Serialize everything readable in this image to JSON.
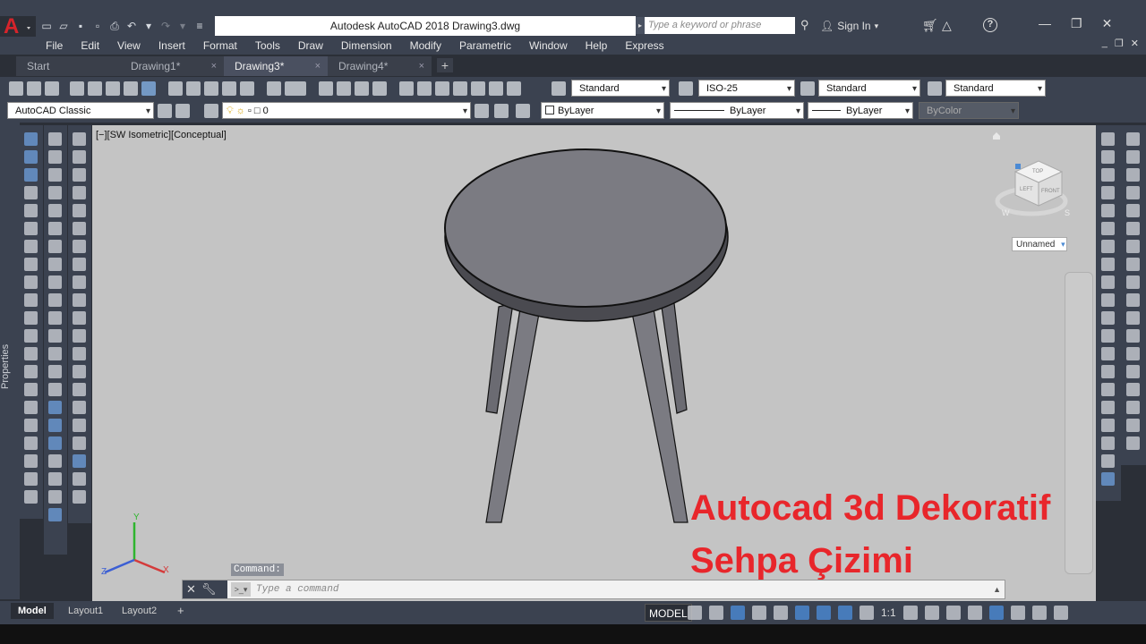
{
  "app": {
    "title": "Autodesk AutoCAD 2018    Drawing3.dwg",
    "logo_letter": "A",
    "search_placeholder": "Type a keyword or phrase",
    "signin_label": "Sign In"
  },
  "menu": [
    "File",
    "Edit",
    "View",
    "Insert",
    "Format",
    "Tools",
    "Draw",
    "Dimension",
    "Modify",
    "Parametric",
    "Window",
    "Help",
    "Express"
  ],
  "tabs": [
    {
      "label": "Start",
      "close": ""
    },
    {
      "label": "Drawing1*",
      "close": "×"
    },
    {
      "label": "Drawing3*",
      "close": "×"
    },
    {
      "label": "Drawing4*",
      "close": "×"
    }
  ],
  "tab_add": "+",
  "toolbar": {
    "text_style": "Standard",
    "dim_style": "ISO-25",
    "table_style": "Standard",
    "mleader_style": "Standard",
    "workspace": "AutoCAD Classic",
    "layer": "0",
    "color": "ByLayer",
    "linetype": "ByLayer",
    "lineweight": "ByLayer",
    "plotstyle": "ByColor"
  },
  "panels": {
    "properties_label": "Properties"
  },
  "viewport": {
    "label": "[−][SW Isometric][Conceptual]",
    "view_name": "Unnamed",
    "viewcube_faces": {
      "top": "TOP",
      "left": "LEFT",
      "front": "FRONT"
    },
    "compass": {
      "w": "W",
      "s": "S"
    },
    "axes": {
      "x": "X",
      "y": "Y",
      "z": "Z"
    }
  },
  "overlay": {
    "line1": "Autocad 3d Dekoratif",
    "line2": "Sehpa Çizimi",
    "color": "#e8262b"
  },
  "command": {
    "history_label": "Command:",
    "placeholder": "Type a command"
  },
  "layout_tabs": [
    "Model",
    "Layout1",
    "Layout2"
  ],
  "layout_add": "+",
  "status": {
    "model_label": "MODEL",
    "scale": "1:1"
  }
}
